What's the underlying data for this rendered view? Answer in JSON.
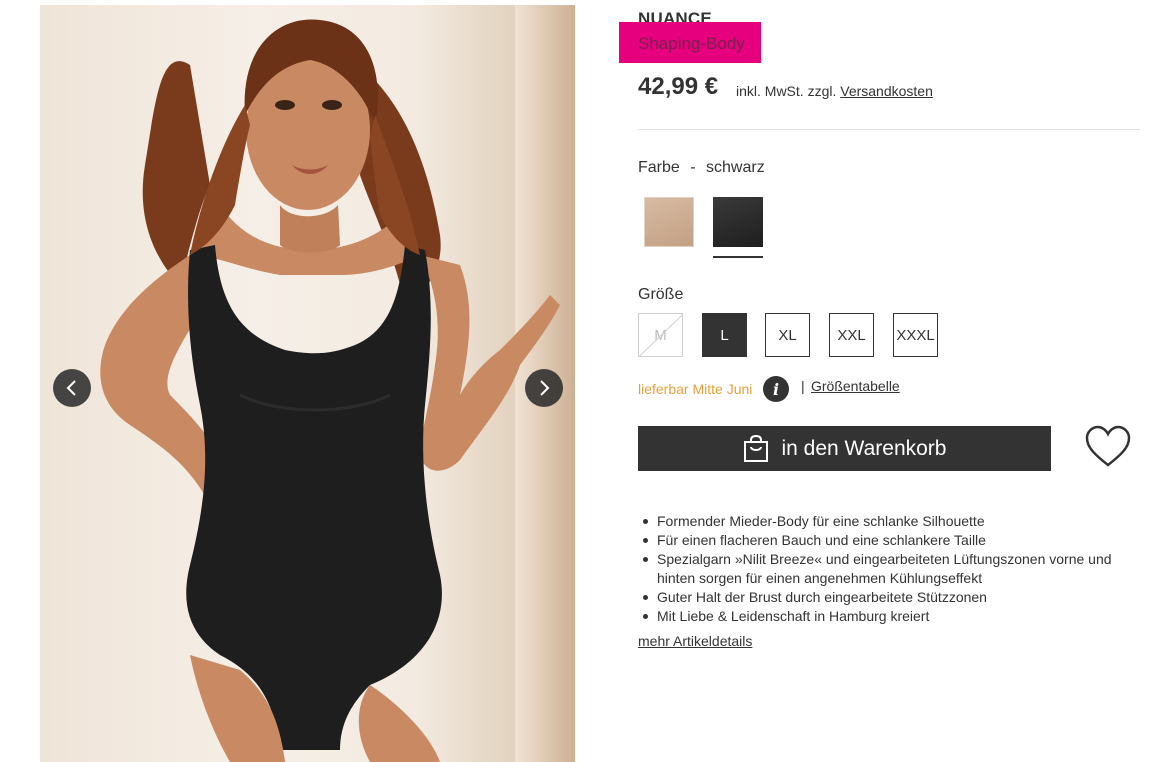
{
  "gallery": {
    "image_alt": "Model wearing black shaping body",
    "prev_icon": "chevron-left-icon",
    "next_icon": "chevron-right-icon"
  },
  "product": {
    "brand": "NUANCE",
    "title": "Shaping-Body",
    "price": "42,99 €",
    "price_note_prefix": "inkl. MwSt. zzgl.",
    "shipping_link": "Versandkosten"
  },
  "color": {
    "label": "Farbe",
    "separator": "-",
    "selected": "schwarz",
    "options": [
      {
        "name": "beige",
        "hex": "#cdad93"
      },
      {
        "name": "schwarz",
        "hex": "#2b2b2b"
      }
    ]
  },
  "size": {
    "label": "Größe",
    "options": [
      {
        "label": "M",
        "state": "unavailable"
      },
      {
        "label": "L",
        "state": "selected"
      },
      {
        "label": "XL",
        "state": "available"
      },
      {
        "label": "XXL",
        "state": "available"
      },
      {
        "label": "XXXL",
        "state": "available"
      }
    ]
  },
  "availability": {
    "text": "lieferbar Mitte Juni",
    "info_icon": "info-icon",
    "separator": "|",
    "size_table_link": "Größentabelle"
  },
  "actions": {
    "cart_label": "in den Warenkorb",
    "cart_icon": "shopping-bag-icon",
    "wishlist_icon": "heart-icon"
  },
  "features": [
    "Formender Mieder-Body für eine schlanke Silhouette",
    "Für einen flacheren Bauch und eine schlankere Taille",
    "Spezialgarn »Nilit Breeze« und eingearbeiteten Lüftungszonen vorne und hinten sorgen für einen angenehmen Kühlungseffekt",
    "Guter Halt der Brust durch eingearbeitete Stützzonen",
    "Mit Liebe & Leidenschaft in Hamburg kreiert"
  ],
  "more_details_link": "mehr Artikeldetails",
  "colors": {
    "dark": "#333333",
    "highlight": "#e6007e",
    "availability": "#e8a13a"
  }
}
